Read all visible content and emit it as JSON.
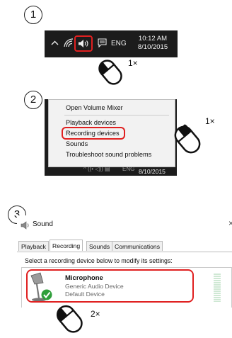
{
  "steps": [
    {
      "number": "1"
    },
    {
      "number": "2"
    },
    {
      "number": "3"
    }
  ],
  "taskbar1": {
    "language": "ENG",
    "time": "10:12 AM",
    "date": "8/10/2015",
    "icons": [
      "chevron-up-icon",
      "wifi-icon",
      "speaker-icon",
      "action-center-icon"
    ]
  },
  "mouse_labels": {
    "step1": "1×",
    "step2": "1×",
    "step3": "2×"
  },
  "context_menu": {
    "items": [
      "Open Volume Mixer",
      "Playback devices",
      "Recording devices",
      "Sounds",
      "Troubleshoot sound problems"
    ],
    "highlighted_index": 2
  },
  "taskbar2": {
    "language": "ENG",
    "date": "8/10/2015"
  },
  "sound_dialog": {
    "title": "Sound",
    "tabs": [
      "Playback",
      "Recording",
      "Sounds",
      "Communications"
    ],
    "active_tab": "Recording",
    "instruction": "Select a recording device below to modify its settings:",
    "device": {
      "name": "Microphone",
      "description": "Generic Audio Device",
      "status": "Default Device"
    }
  },
  "colors": {
    "highlight": "#e02020",
    "taskbar": "#1c1c1c",
    "check_green": "#2e9e3a"
  }
}
